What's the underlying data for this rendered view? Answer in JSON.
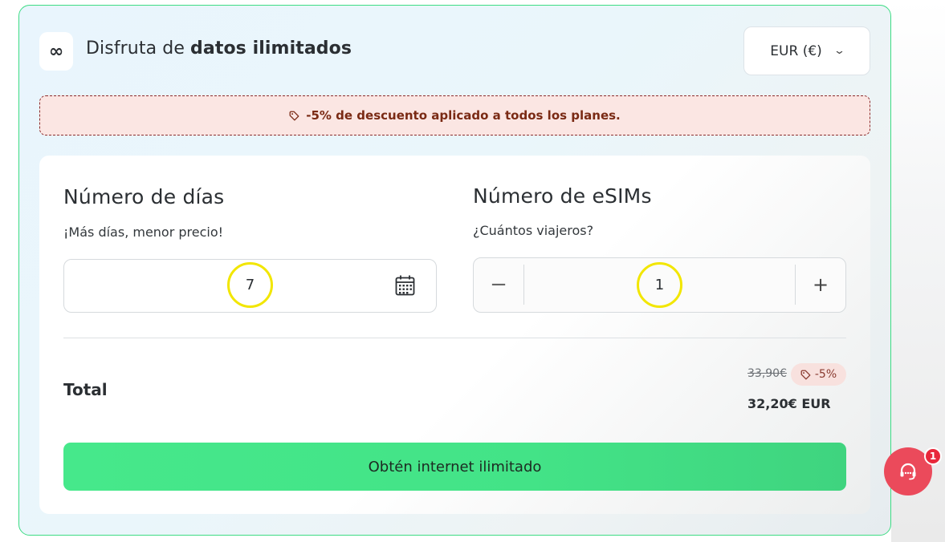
{
  "header": {
    "icon": "infinity-icon",
    "title_prefix": "Disfruta de ",
    "title_bold": "datos ilimitados",
    "currency": "EUR (€)"
  },
  "promo": {
    "text": "-5% de descuento aplicado a todos los planes."
  },
  "days": {
    "title": "Número de días",
    "subtitle": "¡Más días, menor precio!",
    "value": "7"
  },
  "esims": {
    "title": "Número de eSIMs",
    "subtitle": "¿Cuántos viajeros?",
    "value": "1",
    "minus": "−",
    "plus": "+"
  },
  "total": {
    "label": "Total",
    "old_price": "33,90€",
    "discount": "-5%",
    "new_price": "32,20€ EUR"
  },
  "cta": {
    "label": "Obtén internet ilimitado"
  },
  "support": {
    "badge_count": "1"
  },
  "colors": {
    "accent_green": "#46e88b",
    "promo_bg": "#fbe6e3",
    "support_red": "#eb4a5b"
  }
}
